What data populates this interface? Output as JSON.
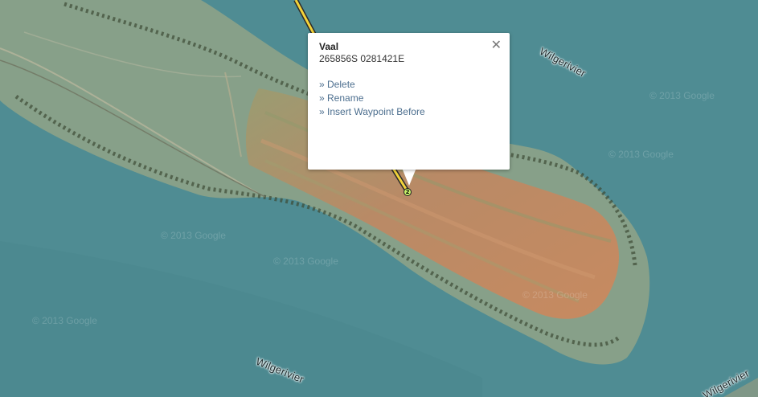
{
  "map": {
    "type": "satellite",
    "colors": {
      "water": "#4f8c93",
      "land": "#8aa38d",
      "field": "#b98a66",
      "route": "#f3d33a"
    },
    "labels": {
      "river_north": "Wilgerivier",
      "river_south": "Wilgerivier",
      "river_corner": "Wilgerivier"
    }
  },
  "watermarks": [
    "© 2013 Google",
    "© 2013 Google",
    "© 2013 Google",
    "© 2013 Google",
    "© 2013 Google",
    "© 2013 Google"
  ],
  "popup": {
    "title": "Vaal",
    "coordinates": "265856S 0281421E",
    "close_icon": "close-icon",
    "actions": [
      "» Delete",
      "» Rename",
      "» Insert Waypoint Before"
    ]
  },
  "waypoint": {
    "number": "2",
    "icon": "waypoint-marker-icon"
  }
}
